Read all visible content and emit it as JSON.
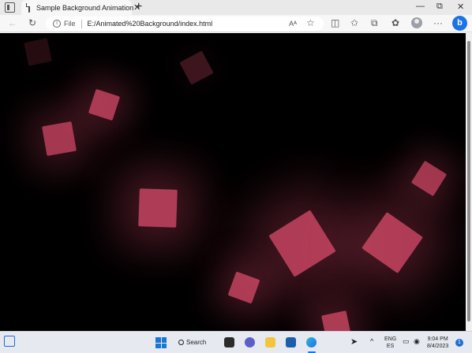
{
  "browser": {
    "tab_title": "Sample Background Animation",
    "tab_close": "✕",
    "new_tab": "+",
    "file_label": "File",
    "url": "E:/Animated%20Background/index.html",
    "bing_label": "b"
  },
  "window_controls": {
    "minimize": "—",
    "restore": "⧉",
    "close": "✕"
  },
  "toolbar_icons": [
    "back-icon",
    "refresh-icon",
    "read-aloud-icon",
    "favorite-icon",
    "split-screen-icon",
    "favorites-icon",
    "collections-icon",
    "extensions-icon",
    "profile-icon",
    "more-icon"
  ],
  "colors": {
    "square_fill": "#e44e70",
    "background": "#000000",
    "accent": "#1a73e8"
  },
  "taskbar": {
    "search_label": "Search",
    "lang_line1": "ENG",
    "lang_line2": "ES",
    "time": "9:04 PM",
    "date": "8/4/2023",
    "notification_count": "1"
  }
}
